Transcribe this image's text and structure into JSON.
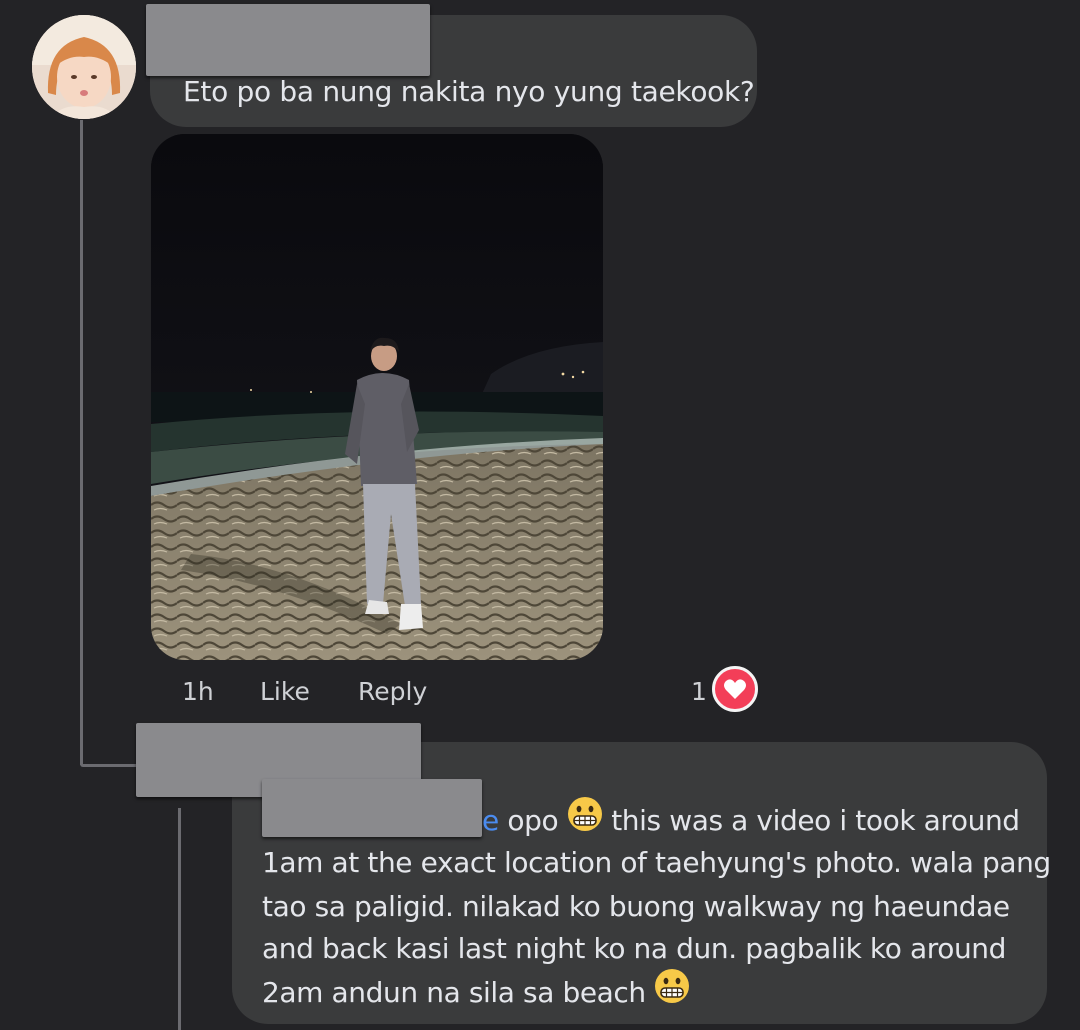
{
  "comment": {
    "text": "Eto po ba nung nakita nyo yung taekook?",
    "time": "1h",
    "like_label": "Like",
    "reply_label": "Reply",
    "reaction_count": "1",
    "reaction_icon": "heart-icon",
    "colors": {
      "bubble": "#3a3b3c",
      "heart": "#f33e58"
    }
  },
  "reply": {
    "mention": "e",
    "line1": "opo",
    "line1_rest": "this was a video i took around",
    "line2": "1am at the exact location of taehyung's photo. wala pang",
    "line3": "tao sa paligid. nilakad ko buong walkway ng haeundae",
    "line4": "and back kasi last night ko na dun. pagbalik ko around",
    "line5": "2am andun na sila sa beach",
    "emoji": "grimacing-face-icon",
    "colors": {
      "mention": "#4b8cf0"
    }
  }
}
